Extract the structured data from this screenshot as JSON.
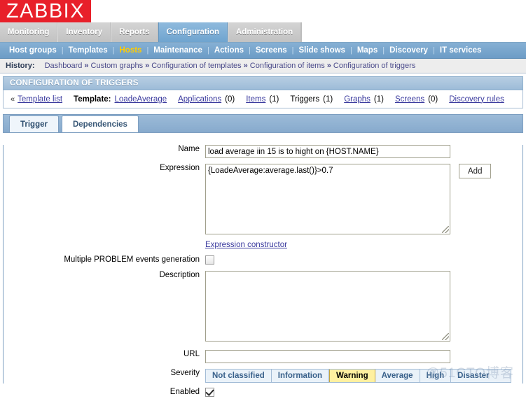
{
  "brand": {
    "logo_text": "ZABBIX",
    "logo_bg": "#E8202A"
  },
  "main_menu": {
    "items": [
      {
        "label": "Monitoring",
        "selected": false
      },
      {
        "label": "Inventory",
        "selected": false
      },
      {
        "label": "Reports",
        "selected": false
      },
      {
        "label": "Configuration",
        "selected": true
      },
      {
        "label": "Administration",
        "selected": false
      }
    ],
    "selected_color": "#6fa4cf"
  },
  "sub_menu": {
    "items": [
      {
        "label": "Host groups",
        "active": false
      },
      {
        "label": "Templates",
        "active": false
      },
      {
        "label": "Hosts",
        "active": true
      },
      {
        "label": "Maintenance",
        "active": false
      },
      {
        "label": "Actions",
        "active": false
      },
      {
        "label": "Screens",
        "active": false
      },
      {
        "label": "Slide shows",
        "active": false
      },
      {
        "label": "Maps",
        "active": false
      },
      {
        "label": "Discovery",
        "active": false
      },
      {
        "label": "IT services",
        "active": false
      }
    ],
    "separator": "|",
    "active_color": "#FFCC00"
  },
  "history": {
    "label": "History:",
    "separator": "»",
    "crumbs": [
      "Dashboard",
      "Custom graphs",
      "Configuration of templates",
      "Configuration of items",
      "Configuration of triggers"
    ]
  },
  "page": {
    "title": "CONFIGURATION OF TRIGGERS"
  },
  "object_nav": {
    "back_arrow": "«",
    "template_list_label": "Template list",
    "template_label": "Template:",
    "template_name": "LoadeAverage",
    "links": [
      {
        "label": "Applications",
        "count": "(0)",
        "current": false
      },
      {
        "label": "Items",
        "count": "(1)",
        "current": false
      },
      {
        "label": "Triggers",
        "count": "(1)",
        "current": true
      },
      {
        "label": "Graphs",
        "count": "(1)",
        "current": false
      },
      {
        "label": "Screens",
        "count": "(0)",
        "current": false
      },
      {
        "label": "Discovery rules",
        "count": "",
        "current": false
      }
    ]
  },
  "tabs": [
    {
      "label": "Trigger",
      "active": true
    },
    {
      "label": "Dependencies",
      "active": false
    }
  ],
  "form": {
    "name": {
      "label": "Name",
      "value": "load average iin 15 is to hight on {HOST.NAME}",
      "placeholder": ""
    },
    "expression": {
      "label": "Expression",
      "value": "{LoadeAverage:average.last()}>0.7",
      "placeholder": "",
      "add_button": "Add"
    },
    "expression_constructor": "Expression constructor",
    "multiple_problem": {
      "label": "Multiple PROBLEM events generation",
      "checked": false
    },
    "description": {
      "label": "Description",
      "value": "",
      "placeholder": ""
    },
    "url": {
      "label": "URL",
      "value": "",
      "placeholder": ""
    },
    "severity": {
      "label": "Severity",
      "selected": "Warning",
      "selected_bg": "#FFF0A0",
      "options": [
        {
          "label": "Not classified",
          "selected": false
        },
        {
          "label": "Information",
          "selected": false
        },
        {
          "label": "Warning",
          "selected": true
        },
        {
          "label": "Average",
          "selected": false
        },
        {
          "label": "High",
          "selected": false
        },
        {
          "label": "Disaster",
          "selected": false
        }
      ]
    },
    "enabled": {
      "label": "Enabled",
      "checked": true
    }
  },
  "watermark": {
    "text": "@51CTO博客"
  }
}
